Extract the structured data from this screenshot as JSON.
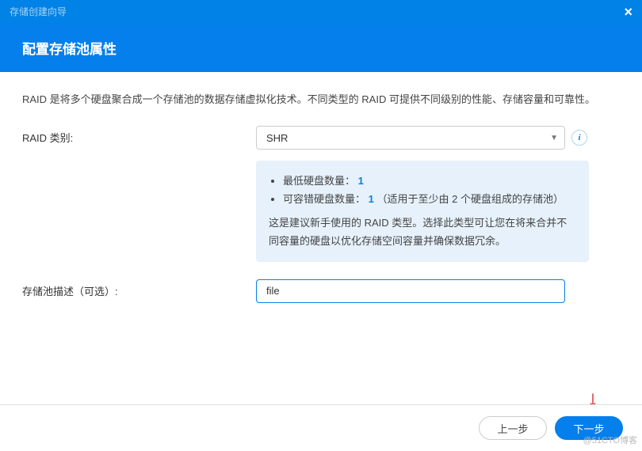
{
  "titlebar": {
    "title": "存储创建向导",
    "close": "×"
  },
  "header": {
    "title": "配置存储池属性"
  },
  "intro": "RAID 是将多个硬盘聚合成一个存储池的数据存储虚拟化技术。不同类型的 RAID 可提供不同级别的性能、存储容量和可靠性。",
  "form": {
    "raid_type_label": "RAID 类别:",
    "raid_type_value": "SHR",
    "desc_label": "存储池描述（可选）:",
    "desc_value": "file"
  },
  "info_panel": {
    "min_disk_label": "最低硬盘数量：",
    "min_disk_value": "1",
    "fault_tol_label": "可容错硬盘数量：",
    "fault_tol_value": "1",
    "fault_tol_suffix": "（适用于至少由 2 个硬盘组成的存储池）",
    "description": "这是建议新手使用的 RAID 类型。选择此类型可让您在将来合并不同容量的硬盘以优化存储空间容量并确保数据冗余。"
  },
  "footer": {
    "prev": "上一步",
    "next": "下一步"
  },
  "watermark": "@51CTO博客"
}
